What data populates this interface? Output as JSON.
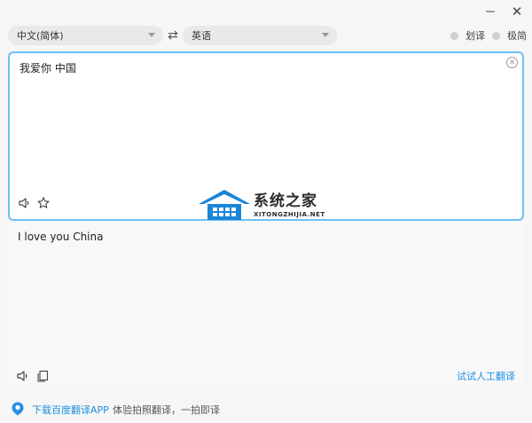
{
  "window": {
    "minimize_label": "—",
    "close_label": "✕"
  },
  "toolbar": {
    "source_language": "中文(简体)",
    "target_language": "英语",
    "swap_symbol": "⇄",
    "toggles": [
      {
        "label": "划译",
        "enabled": false
      },
      {
        "label": "极简",
        "enabled": false
      }
    ]
  },
  "source": {
    "text": "我爱你 中国",
    "clear_symbol": "✕"
  },
  "result": {
    "text": "I love you China",
    "human_translation_link": "试试人工翻译"
  },
  "watermark": {
    "title": "系统之家",
    "subtitle": "XITONGZHIJIA.NET",
    "colors": {
      "house": "#1a86d8"
    }
  },
  "footer": {
    "download_link": "下载百度翻译APP",
    "note": "体验拍照翻译，一拍即译"
  },
  "colors": {
    "accent": "#1e8fe0",
    "focus_border": "#6cc0f3"
  },
  "icons": [
    "minimize-icon",
    "close-icon",
    "swap-icon",
    "clear-icon",
    "speaker-icon",
    "star-icon",
    "copy-icon",
    "app-icon"
  ]
}
